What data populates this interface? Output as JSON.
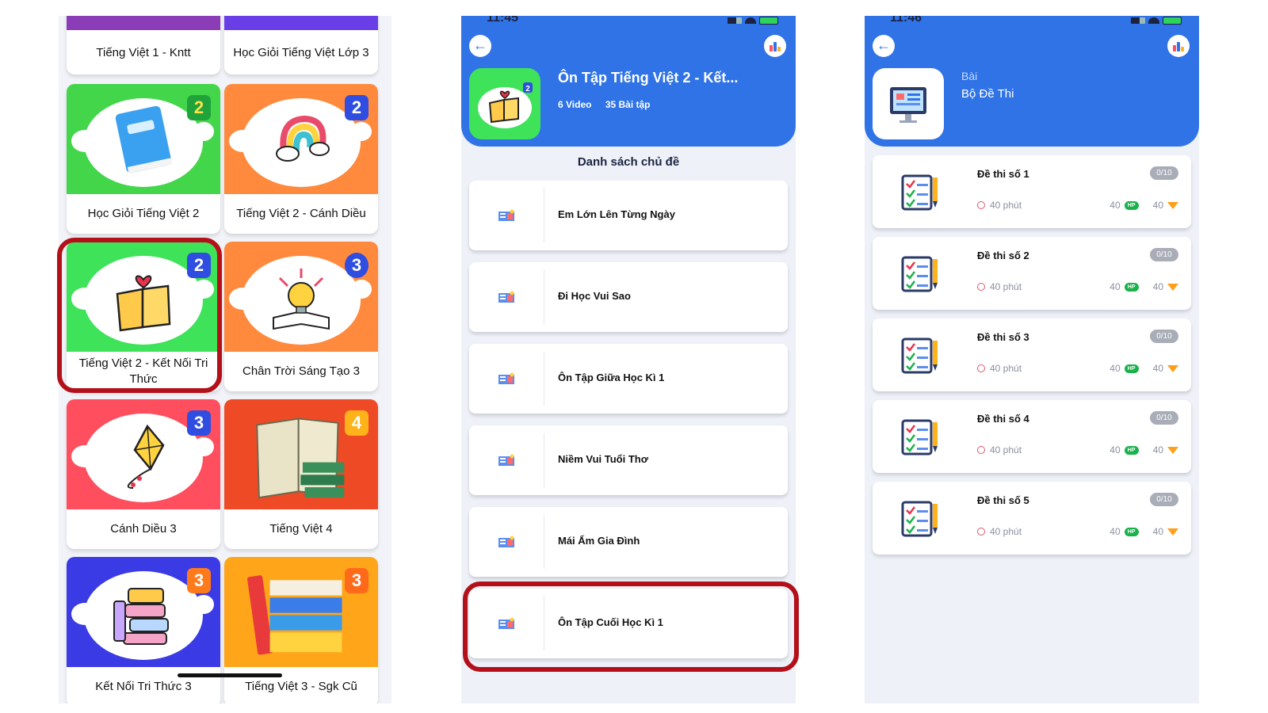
{
  "panel1": {
    "courses_top": [
      {
        "title": "Tiếng Việt 1 - Kntt",
        "color": "#8b3db8"
      },
      {
        "title": "Học Giỏi Tiếng Việt Lớp 3",
        "color": "#6a3ee6"
      }
    ],
    "courses": [
      {
        "title": "Học Giỏi Tiếng Việt 2",
        "grade": "2",
        "bg": "#43d64a",
        "badge": "#1fa33a",
        "icon": "blue-book-icon"
      },
      {
        "title": "Tiếng Việt 2 - Cánh Diều",
        "grade": "2",
        "bg": "#ff8a3d",
        "badge": "#2f4de0",
        "icon": "rainbow-cloud-icon"
      },
      {
        "title": "Tiếng Việt 2 - Kết Nối Tri Thức",
        "grade": "2",
        "bg": "#3ee35a",
        "badge": "#2f4de0",
        "icon": "open-book-heart-icon"
      },
      {
        "title": "Chân Trời Sáng Tạo 3",
        "grade": "3",
        "bg": "#ff8a3d",
        "badge": "#2f4de0",
        "icon": "lightbulb-book-icon"
      },
      {
        "title": "Cánh Diều 3",
        "grade": "3",
        "bg": "#ff4f5e",
        "badge": "#2f4de0",
        "icon": "kite-icon"
      },
      {
        "title": "Tiếng Việt 4",
        "grade": "4",
        "bg": "#ef4a26",
        "badge": "#ffb21a",
        "icon": "books-stack-icon"
      },
      {
        "title": "Kết Nối Tri Thức 3",
        "grade": "3",
        "bg": "#3b3be6",
        "badge": "#ff7a1a",
        "icon": "cute-books-icon"
      },
      {
        "title": "Tiếng Việt 3 - Sgk Cũ",
        "grade": "3",
        "bg": "#ffa51a",
        "badge": "#ff6a1a",
        "icon": "colored-books-icon"
      }
    ]
  },
  "panel2": {
    "status_time": "11:45",
    "title": "Ôn Tập Tiếng Việt 2 - Kết...",
    "videos": "6 Video",
    "exercises": "35 Bài tập",
    "list_title": "Danh sách chủ đề",
    "topics": [
      "Em Lớn Lên Từng Ngày",
      "Đi Học Vui Sao",
      "Ôn Tập Giữa Học Kì 1",
      "Niềm Vui Tuổi Thơ",
      "Mái Ấm Gia Đình",
      "Ôn Tập Cuối Học Kì 1"
    ]
  },
  "panel3": {
    "status_time": "11:46",
    "pre_title": "Bài",
    "title": "Bộ Đề Thi",
    "exams": [
      {
        "name": "Đề thi số 1",
        "score": "0/10",
        "time": "40 phút",
        "hp": "40",
        "gem": "40"
      },
      {
        "name": "Đề thi số 2",
        "score": "0/10",
        "time": "40 phút",
        "hp": "40",
        "gem": "40"
      },
      {
        "name": "Đề thi số 3",
        "score": "0/10",
        "time": "40 phút",
        "hp": "40",
        "gem": "40"
      },
      {
        "name": "Đề thi số 4",
        "score": "0/10",
        "time": "40 phút",
        "hp": "40",
        "gem": "40"
      },
      {
        "name": "Đề thi số 5",
        "score": "0/10",
        "time": "40 phút",
        "hp": "40",
        "gem": "40"
      }
    ],
    "hp_label": "HP"
  },
  "colors": {
    "accent": "#2f73e6",
    "highlight": "#b3101a"
  }
}
